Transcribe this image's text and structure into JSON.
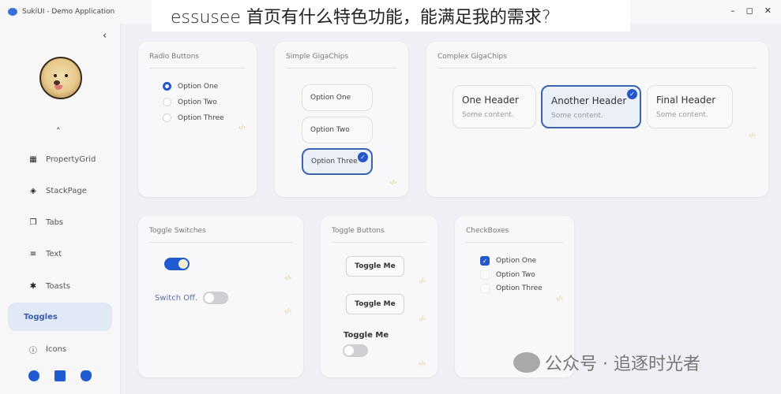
{
  "window": {
    "title": "SukiUI - Demo Application",
    "controls": {
      "minimize": "–",
      "maximize": "◻",
      "close": "✕"
    }
  },
  "overlay_heading": "essusee 首页有什么特色功能，能满足我的需求?",
  "sidebar": {
    "collapse_icon": "‹",
    "scroll_up_icon": "˄",
    "items": [
      {
        "label": "PropertyGrid",
        "icon": "▦"
      },
      {
        "label": "StackPage",
        "icon": "◈"
      },
      {
        "label": "Tabs",
        "icon": "❐"
      },
      {
        "label": "Text",
        "icon": "≡"
      },
      {
        "label": "Toasts",
        "icon": "✱"
      },
      {
        "label": "Toggles",
        "icon": "",
        "active": true
      },
      {
        "label": "Icons",
        "icon": "ⓘ"
      }
    ],
    "footer_icons": [
      "github-icon",
      "window-icon",
      "cat-icon"
    ]
  },
  "code_icon": "‹/›",
  "radio_buttons": {
    "title": "Radio Buttons",
    "options": [
      "Option One",
      "Option Two",
      "Option Three"
    ],
    "selected": "Option One"
  },
  "simple_gigachips": {
    "title": "Simple GigaChips",
    "options": [
      "Option One",
      "Option Two",
      "Option Three"
    ],
    "selected": "Option Three",
    "check": "✓"
  },
  "complex_gigachips": {
    "title": "Complex GigaChips",
    "chips": [
      {
        "header": "One Header",
        "content": "Some content."
      },
      {
        "header": "Another Header",
        "content": "Some content.",
        "selected": true
      },
      {
        "header": "Final Header",
        "content": "Some content."
      }
    ]
  },
  "toggle_switches": {
    "title": "Toggle Switches",
    "switch1_on": true,
    "switch2_label": "Switch Off.",
    "switch2_on": false
  },
  "toggle_buttons": {
    "title": "Toggle Buttons",
    "button1": "Toggle Me",
    "button2": "Toggle Me",
    "switch_label": "Toggle Me",
    "switch_on": false
  },
  "checkboxes": {
    "title": "CheckBoxes",
    "options": [
      "Option One",
      "Option Two",
      "Option Three"
    ],
    "checked": [
      "Option One"
    ],
    "check": "✓"
  },
  "watermark": "公众号 · 追逐时光者",
  "colors": {
    "accent": "#2456c9",
    "active_nav_bg": "#e1e8f6",
    "code_icon": "#e3c870"
  }
}
